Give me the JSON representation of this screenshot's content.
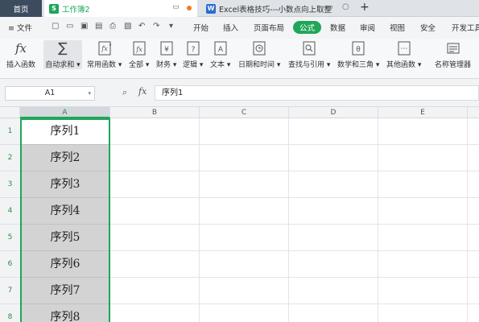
{
  "tabs": {
    "home": "首页",
    "doc1": {
      "icon": "S",
      "label": "工作簿2"
    },
    "doc2": {
      "icon": "W",
      "label": "Excel表格技巧---小数点向上取整"
    },
    "add": "+"
  },
  "menu": {
    "file": "≡ 文件",
    "items": [
      "开始",
      "插入",
      "页面布局",
      "公式",
      "数据",
      "审阅",
      "视图",
      "安全",
      "开发工具"
    ],
    "active": "公式"
  },
  "ribbon": {
    "items": [
      {
        "label": "插入函数",
        "icon": "fx-icon",
        "glyph": "fx"
      },
      {
        "label": "自动求和 ▾",
        "icon": "sigma-icon",
        "glyph": "∑"
      },
      {
        "label": "常用函数 ▾",
        "icon": "common-functions-icon",
        "glyph": "☆"
      },
      {
        "label": "全部 ▾",
        "icon": "all-functions-icon",
        "glyph": "fx"
      },
      {
        "label": "财务 ▾",
        "icon": "finance-icon",
        "glyph": "¥"
      },
      {
        "label": "逻辑 ▾",
        "icon": "logic-icon",
        "glyph": "?"
      },
      {
        "label": "文本 ▾",
        "icon": "text-icon",
        "glyph": "A"
      },
      {
        "label": "日期和时间 ▾",
        "icon": "datetime-icon",
        "glyph": "◷"
      },
      {
        "label": "查找与引用 ▾",
        "icon": "lookup-icon",
        "glyph": "⌕"
      },
      {
        "label": "数学和三角 ▾",
        "icon": "math-icon",
        "glyph": "θ"
      },
      {
        "label": "其他函数 ▾",
        "icon": "other-functions-icon",
        "glyph": "⋯"
      },
      {
        "label": "名称管理器",
        "icon": "name-manager-icon",
        "glyph": "▤"
      }
    ]
  },
  "formula_bar": {
    "name_box": "A1",
    "fx": "fx",
    "value": "序列1"
  },
  "grid": {
    "columns": [
      "A",
      "B",
      "C",
      "D",
      "E"
    ],
    "rows": [
      "1",
      "2",
      "3",
      "4",
      "5",
      "6",
      "7",
      "8"
    ],
    "column_a": [
      "序列1",
      "序列2",
      "序列3",
      "序列4",
      "序列5",
      "序列6",
      "序列7",
      "序列8"
    ],
    "selection_color": "#1fa65a"
  }
}
